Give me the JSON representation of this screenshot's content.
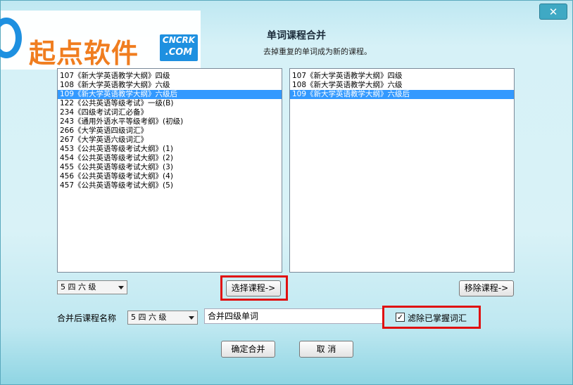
{
  "window": {
    "title": "单词课程合并",
    "subtitle": "去掉重复的单词成为新的课程。",
    "close_label": "✕"
  },
  "watermark": {
    "brand": "起点软件",
    "badge_line1": "CNCRK",
    "badge_line2": ".COM"
  },
  "left_list": {
    "items": [
      {
        "text": "107《新大学英语教学大纲》四级",
        "selected": false
      },
      {
        "text": "108《新大学英语教学大纲》六级",
        "selected": false
      },
      {
        "text": "109《新大学英语教学大纲》六级后",
        "selected": true
      },
      {
        "text": "122《公共英语等级考试》一级(B)",
        "selected": false
      },
      {
        "text": "234《四级考试词汇必备》",
        "selected": false
      },
      {
        "text": "243《通用外语水平等级考纲》(初级)",
        "selected": false
      },
      {
        "text": "266《大学英语四级词汇》",
        "selected": false
      },
      {
        "text": "267《大学英语六级词汇》",
        "selected": false
      },
      {
        "text": "453《公共英语等级考试大纲》(1)",
        "selected": false
      },
      {
        "text": "454《公共英语等级考试大纲》(2)",
        "selected": false
      },
      {
        "text": "455《公共英语等级考试大纲》(3)",
        "selected": false
      },
      {
        "text": "456《公共英语等级考试大纲》(4)",
        "selected": false
      },
      {
        "text": "457《公共英语等级考试大纲》(5)",
        "selected": false
      }
    ]
  },
  "right_list": {
    "items": [
      {
        "text": "107《新大学英语教学大纲》四级",
        "selected": false
      },
      {
        "text": "108《新大学英语教学大纲》六级",
        "selected": false
      },
      {
        "text": "109《新大学英语教学大纲》六级后",
        "selected": true
      }
    ]
  },
  "category_combo": {
    "value": "5 四 六 级"
  },
  "select_button": {
    "label": "选择课程->"
  },
  "remove_button": {
    "label": "移除课程->"
  },
  "merged_name_label": "合并后课程名称",
  "merged_category_combo": {
    "value": "5 四 六 级"
  },
  "merged_name_input": {
    "value": "合并四级单词"
  },
  "filter_checkbox": {
    "label": "滤除已掌握词汇",
    "checked": true,
    "mark": "✓"
  },
  "confirm_button": {
    "label": "确定合并"
  },
  "cancel_button": {
    "label": "取 消"
  },
  "colors": {
    "selection": "#3399ff",
    "highlight_box": "#e01010",
    "brand_orange": "#f07d1f",
    "brand_blue": "#1e90e0"
  }
}
